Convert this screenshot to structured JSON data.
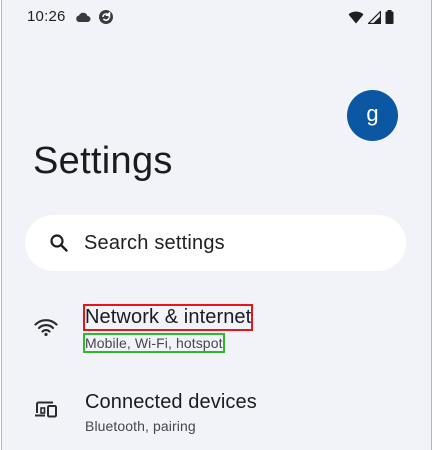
{
  "status_bar": {
    "time": "10:26",
    "left_icons": [
      "cloud-icon",
      "sync-icon"
    ],
    "right_icons": [
      "wifi-icon",
      "cell-signal-icon",
      "battery-icon"
    ]
  },
  "account": {
    "avatar_letter": "g",
    "avatar_color": "#0b57a3"
  },
  "header": {
    "title": "Settings"
  },
  "search": {
    "placeholder": "Search settings",
    "icon": "search-icon"
  },
  "settings_list": [
    {
      "icon": "wifi-icon",
      "title": "Network & internet",
      "subtitle": "Mobile, Wi-Fi, hotspot"
    },
    {
      "icon": "connected-devices-icon",
      "title": "Connected devices",
      "subtitle": "Bluetooth, pairing"
    }
  ],
  "colors": {
    "background": "#f1f3f8",
    "surface": "#ffffff",
    "accent": "#0b57a3",
    "highlight_title": "#e8141c",
    "highlight_subtitle": "#2dbb2d"
  }
}
